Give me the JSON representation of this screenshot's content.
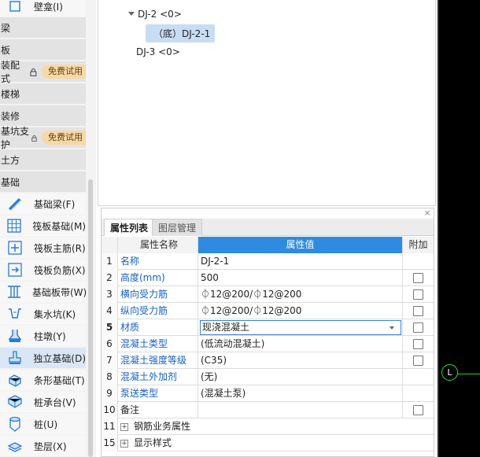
{
  "sidebar": {
    "top_item": "壁龛(I)",
    "categories": [
      "梁",
      "板",
      "装配式",
      "楼梯",
      "装修",
      "基坑支护",
      "土方",
      "基础"
    ],
    "trial_badge": "免费试用",
    "items": [
      {
        "label": "基础梁(F)",
        "icon": "foundation-beam-icon"
      },
      {
        "label": "筏板基础(M)",
        "icon": "raft-foundation-icon"
      },
      {
        "label": "筏板主筋(R)",
        "icon": "raft-main-rebar-icon"
      },
      {
        "label": "筏板负筋(X)",
        "icon": "raft-negative-rebar-icon"
      },
      {
        "label": "基础板带(W)",
        "icon": "foundation-strip-icon"
      },
      {
        "label": "集水坑(K)",
        "icon": "sump-pit-icon"
      },
      {
        "label": "柱墩(Y)",
        "icon": "column-pier-icon"
      },
      {
        "label": "独立基础(D)",
        "icon": "isolated-footing-icon"
      },
      {
        "label": "条形基础(T)",
        "icon": "strip-footing-icon"
      },
      {
        "label": "桩承台(V)",
        "icon": "pile-cap-icon"
      },
      {
        "label": "桩(U)",
        "icon": "pile-icon"
      },
      {
        "label": "垫层(X)",
        "icon": "cushion-layer-icon"
      }
    ]
  },
  "tree": {
    "node1": "DJ-2 <0>",
    "node1_child": "（底）DJ-2-1",
    "node2": "DJ-3 <0>"
  },
  "panel": {
    "close": "×",
    "tabs": [
      "属性列表",
      "图层管理"
    ],
    "headers": {
      "name": "属性名称",
      "value": "属性值",
      "add": "附加"
    },
    "rows": [
      {
        "num": "1",
        "name": "名称",
        "value": "DJ-2-1",
        "blue": true,
        "check": false
      },
      {
        "num": "2",
        "name": "高度(mm)",
        "value": "500",
        "blue": true,
        "check": true
      },
      {
        "num": "3",
        "name": "横向受力筋",
        "value": "⏀12@200/⏀12@200",
        "blue": true,
        "check": true
      },
      {
        "num": "4",
        "name": "纵向受力筋",
        "value": "⏀12@200/⏀12@200",
        "blue": true,
        "check": true
      },
      {
        "num": "5",
        "name": "材质",
        "value": "现浇混凝土",
        "blue": true,
        "check": true
      },
      {
        "num": "6",
        "name": "混凝土类型",
        "value": "(低流动混凝土)",
        "blue": true,
        "check": true
      },
      {
        "num": "7",
        "name": "混凝土强度等级",
        "value": "(C35)",
        "blue": true,
        "check": true
      },
      {
        "num": "8",
        "name": "混凝土外加剂",
        "value": "(无)",
        "blue": true,
        "check": false
      },
      {
        "num": "9",
        "name": "泵送类型",
        "value": "(混凝土泵)",
        "blue": true,
        "check": false
      },
      {
        "num": "10",
        "name": "备注",
        "value": "",
        "blue": false,
        "check": true
      },
      {
        "num": "11",
        "name": "钢筋业务属性",
        "value": "",
        "blue": false,
        "check": false
      },
      {
        "num": "15",
        "name": "显示样式",
        "value": "",
        "blue": false,
        "check": false
      }
    ]
  },
  "viewport": {
    "axis_label": "L"
  }
}
